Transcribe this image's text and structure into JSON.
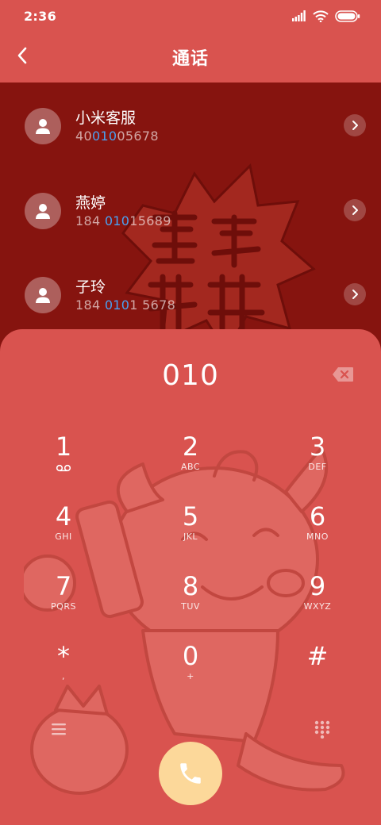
{
  "status_bar": {
    "time": "2:36"
  },
  "header": {
    "title": "通话"
  },
  "contacts": [
    {
      "name": "小米客服",
      "number_pre": "40",
      "number_hl": "010",
      "number_post": "05678"
    },
    {
      "name": "燕婷",
      "number_pre": "184 ",
      "number_hl": "010",
      "number_post": "15689"
    },
    {
      "name": "子玲",
      "number_pre": "184 ",
      "number_hl": "010",
      "number_post": "1 5678"
    }
  ],
  "dialpad": {
    "dialed": "010",
    "keys": [
      {
        "digit": "1",
        "letters": ""
      },
      {
        "digit": "2",
        "letters": "ABC"
      },
      {
        "digit": "3",
        "letters": "DEF"
      },
      {
        "digit": "4",
        "letters": "GHI"
      },
      {
        "digit": "5",
        "letters": "JKL"
      },
      {
        "digit": "6",
        "letters": "MNO"
      },
      {
        "digit": "7",
        "letters": "PQRS"
      },
      {
        "digit": "8",
        "letters": "TUV"
      },
      {
        "digit": "9",
        "letters": "WXYZ"
      },
      {
        "digit": "*",
        "letters": ","
      },
      {
        "digit": "0",
        "letters": "+"
      },
      {
        "digit": "#",
        "letters": ""
      }
    ]
  },
  "icons": {
    "back": "back-arrow-icon",
    "avatar": "person-icon",
    "detail": "chevron-right-icon",
    "backspace": "backspace-icon",
    "voicemail": "voicemail-icon",
    "menu": "menu-icon",
    "dialpad": "dialpad-icon",
    "call": "phone-icon"
  },
  "colors": {
    "header_bg": "#d9534f",
    "list_bg": "#86140f",
    "highlight": "#4aa0f0",
    "call_button": "#fcd89a"
  }
}
